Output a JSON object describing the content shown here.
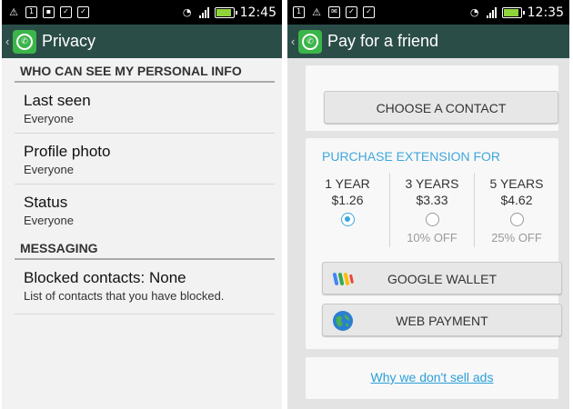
{
  "left": {
    "status": {
      "time": "12:45",
      "notification_box_label": "1"
    },
    "actionbar": {
      "back": "‹",
      "title": "Privacy"
    },
    "section1": "WHO CAN SEE MY PERSONAL INFO",
    "items": [
      {
        "title": "Last seen",
        "sub": "Everyone"
      },
      {
        "title": "Profile photo",
        "sub": "Everyone"
      },
      {
        "title": "Status",
        "sub": "Everyone"
      }
    ],
    "section2": "MESSAGING",
    "blocked": {
      "title": "Blocked contacts: None",
      "sub": "List of contacts that you have blocked."
    }
  },
  "right": {
    "status": {
      "time": "12:35",
      "notification_box_label": "1"
    },
    "actionbar": {
      "back": "‹",
      "title": "Pay for a friend"
    },
    "choose_contact": "CHOOSE A CONTACT",
    "extension_label": "PURCHASE EXTENSION FOR",
    "plans": [
      {
        "name": "1 YEAR",
        "price": "$1.26",
        "selected": true,
        "off": ""
      },
      {
        "name": "3 YEARS",
        "price": "$3.33",
        "selected": false,
        "off": "10% OFF"
      },
      {
        "name": "5 YEARS",
        "price": "$4.62",
        "selected": false,
        "off": "25% OFF"
      }
    ],
    "google_wallet": "GOOGLE WALLET",
    "web_payment": "WEB PAYMENT",
    "why_link": "Why we don't sell ads"
  },
  "colors": {
    "actionbar": "#2b4d48",
    "whatsapp_green": "#3bb54a",
    "accent_blue": "#3fa7dc"
  }
}
